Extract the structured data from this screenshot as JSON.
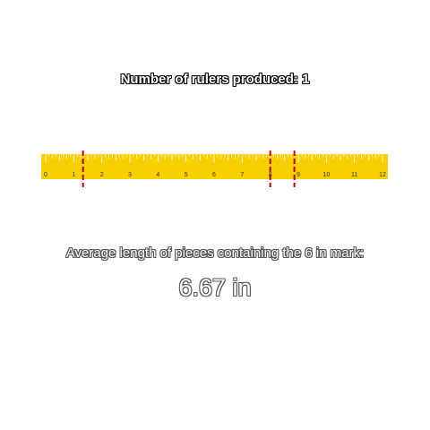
{
  "title_text": "Number of rulers produced: 1",
  "ruler": {
    "length_in": 12,
    "ticks_per_inch": 8,
    "labels": [
      "0",
      "1",
      "2",
      "3",
      "4",
      "5",
      "6",
      "7",
      "8",
      "9",
      "10",
      "11",
      "12"
    ],
    "cut_positions_in": [
      1.33,
      8.0,
      8.86
    ],
    "colors": {
      "body": "#f7d000",
      "tick": "#ffffff",
      "label": "#333333",
      "cut": "#c00000"
    }
  },
  "average_label": "Average length of pieces containing the 6 in mark:",
  "average_value": "6.67 in"
}
